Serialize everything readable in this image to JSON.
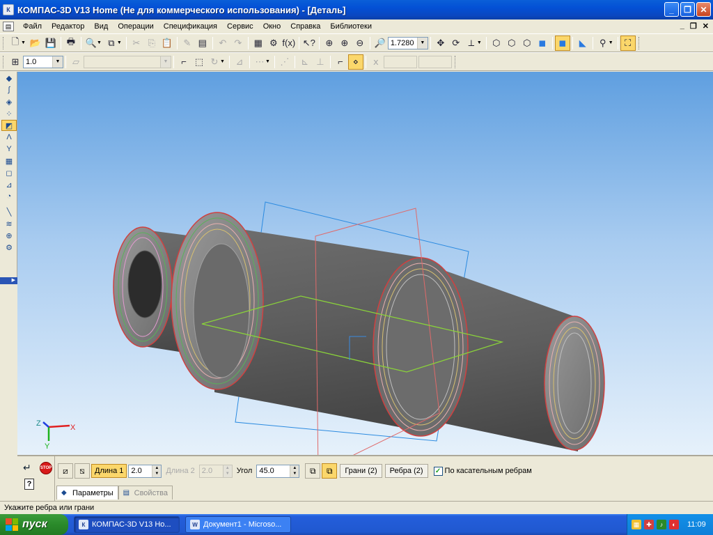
{
  "window": {
    "title": "КОМПАС-3D V13 Home (Не для коммерческого использования) - [Деталь]",
    "icon_text": "К"
  },
  "menu": {
    "items": [
      "Файл",
      "Редактор",
      "Вид",
      "Операции",
      "Спецификация",
      "Сервис",
      "Окно",
      "Справка",
      "Библиотеки"
    ]
  },
  "toolbar": {
    "zoom_value": "1.7280",
    "line_scale": "1.0"
  },
  "axes": {
    "x": "X",
    "y": "Y",
    "z": "Z"
  },
  "panel": {
    "stop_label": "STOP",
    "length1_label": "Длина 1",
    "length1_value": "2.0",
    "length2_label": "Длина 2",
    "length2_value": "2.0",
    "angle_label": "Угол",
    "angle_value": "45.0",
    "faces_button": "Грани (2)",
    "edges_button": "Ребра (2)",
    "tangent_checkbox_label": "По касательным ребрам",
    "tangent_checked": true,
    "tab_params": "Параметры",
    "tab_props": "Свойства"
  },
  "status": {
    "prompt": "Укажите ребра или грани"
  },
  "taskbar": {
    "start_label": "пуск",
    "tasks": [
      "КОМПАС-3D V13 Ho...",
      "Документ1 - Microso..."
    ],
    "clock": "11:09"
  },
  "colors": {
    "title_bar": "#0a5fd8",
    "viewport_top": "#5f9fe0",
    "viewport_bottom": "#e6f1fb",
    "highlight": "#fbd76b",
    "plane_blue": "#2a8ae0",
    "plane_red": "#e06a6a",
    "plane_green": "#8ad23a"
  }
}
